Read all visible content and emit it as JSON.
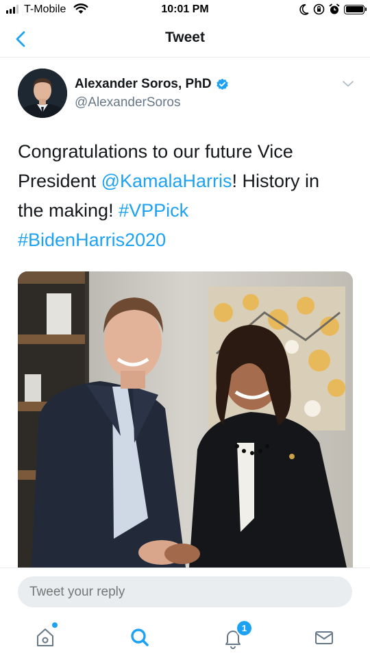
{
  "status_bar": {
    "carrier": "T-Mobile",
    "time": "10:01 PM"
  },
  "nav": {
    "title": "Tweet"
  },
  "tweet": {
    "author_name": "Alexander Soros, PhD",
    "author_handle": "@AlexanderSoros",
    "verified": true,
    "text": {
      "line1": "Congratulations to our future Vice",
      "line2_prefix": "President ",
      "mention": "@KamalaHarris",
      "line2_suffix": "! History in",
      "line3_prefix": "the making! ",
      "hashtag1": "#VPPick",
      "hashtag2": "#BidenHarris2020"
    }
  },
  "reply": {
    "placeholder": "Tweet your reply"
  },
  "tab_bar": {
    "notifications_badge": "1"
  },
  "colors": {
    "accent": "#1da1f2",
    "text_primary": "#14171a",
    "text_secondary": "#657786",
    "divider": "#e6ecf0",
    "reply_bg": "#e9edf0"
  },
  "icons": [
    "signal-icon",
    "wifi-icon",
    "moon-icon",
    "lock-rotation-icon",
    "alarm-icon",
    "battery-icon",
    "back-chevron-icon",
    "verified-badge-icon",
    "chevron-down-icon",
    "home-icon",
    "search-icon",
    "notifications-bell-icon",
    "messages-envelope-icon"
  ]
}
